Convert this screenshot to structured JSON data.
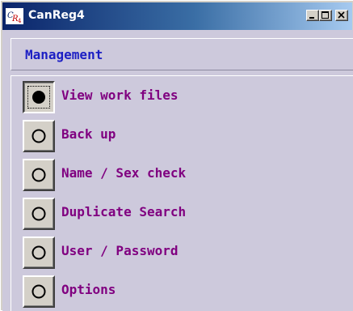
{
  "window": {
    "title": "CanReg4",
    "icon": "canreg-app-icon",
    "icon_text": "CR4",
    "controls": [
      "minimize-icon",
      "maximize-icon",
      "close-icon"
    ]
  },
  "header": {
    "title": "Management"
  },
  "menu": {
    "items": [
      {
        "label": "View work files",
        "selected": true
      },
      {
        "label": "Back up",
        "selected": false
      },
      {
        "label": "Name / Sex check",
        "selected": false
      },
      {
        "label": "Duplicate Search",
        "selected": false
      },
      {
        "label": "User / Password",
        "selected": false
      },
      {
        "label": "Options",
        "selected": false
      }
    ]
  },
  "colors": {
    "title_gradient_start": "#0a246a",
    "title_gradient_end": "#a6caf0",
    "panel_background": "#cdc9dc",
    "header_text": "#1c1fc4",
    "menu_text": "#800080"
  }
}
